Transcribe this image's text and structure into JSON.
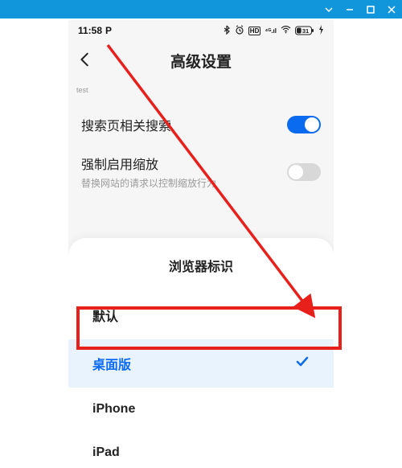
{
  "status": {
    "time": "11:58",
    "indicator": "P",
    "battery": "31"
  },
  "header": {
    "title": "高级设置"
  },
  "testLabel": "test",
  "settings": {
    "row1": {
      "title": "搜索页相关搜索"
    },
    "row2": {
      "title": "强制启用缩放",
      "sub": "替换网站的请求以控制缩放行为"
    }
  },
  "sheet": {
    "title": "浏览器标识",
    "items": [
      {
        "label": "默认"
      },
      {
        "label": "桌面版"
      },
      {
        "label": "iPhone"
      },
      {
        "label": "iPad"
      }
    ]
  }
}
